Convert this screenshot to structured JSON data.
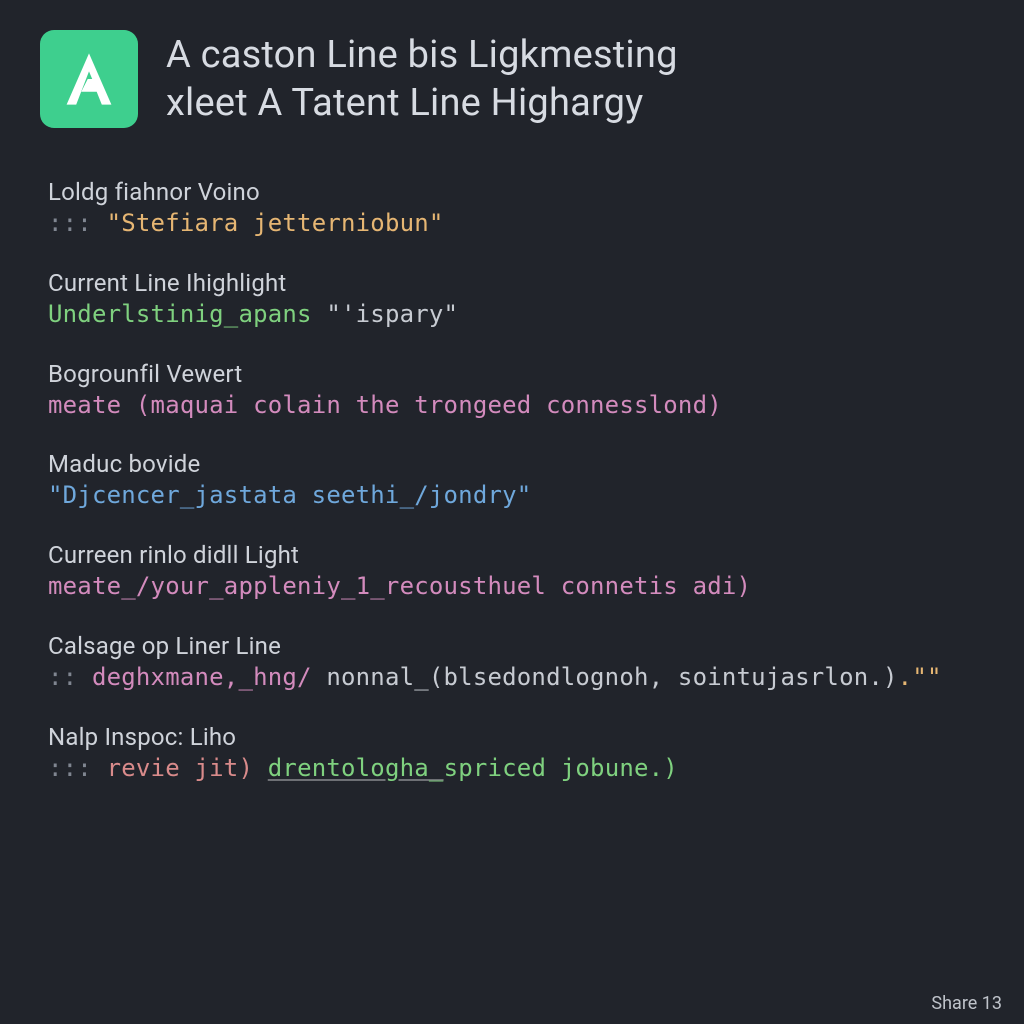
{
  "header": {
    "title_line1": "A caston Line bis Ligkmesting",
    "title_line2": "xleet A Tatent Line Highargy"
  },
  "groups": [
    {
      "label": "Loldg fiahnor Voino",
      "parts": [
        {
          "cls": "c-marker",
          "text": "::: "
        },
        {
          "cls": "c-orange",
          "text": "\"Stefiara jetterniobun\""
        }
      ]
    },
    {
      "label": "Current Line Ihighlight",
      "parts": [
        {
          "cls": "c-green",
          "text": "Underlstinig_apans "
        },
        {
          "cls": "c-gray",
          "text": "\"'ispary\""
        }
      ]
    },
    {
      "label": "Bogrounfil Vewert",
      "parts": [
        {
          "cls": "c-pink",
          "text": "meate "
        },
        {
          "cls": "c-pink",
          "text": "(maquai colain the trongeed connesslond)"
        }
      ]
    },
    {
      "label": "Maduc bovide",
      "parts": [
        {
          "cls": "c-blue",
          "text": "\"Djcencer_jastata seethi_/jondry\""
        }
      ]
    },
    {
      "label": "Curreen rinlo didll Light",
      "parts": [
        {
          "cls": "c-pink",
          "text": "meate_/your_appleniy_1_recousthuel connetis adi)"
        }
      ]
    },
    {
      "label": "Calsage op Liner Line",
      "parts": [
        {
          "cls": "c-marker",
          "text": ":: "
        },
        {
          "cls": "c-pink",
          "text": "deghxmane,_hng/ "
        },
        {
          "cls": "c-gray",
          "text": "nonnal_(blsedondlognoh, sointujasrlon.)"
        },
        {
          "cls": "c-orange",
          "text": ".\"\""
        }
      ]
    },
    {
      "label": "Nalp Inspoc: Liho",
      "parts": [
        {
          "cls": "c-marker",
          "text": "::: "
        },
        {
          "cls": "c-red",
          "text": "revie jit) "
        },
        {
          "cls": "c-green ul",
          "text": "drentologha_"
        },
        {
          "cls": "c-green",
          "text": "spriced jobune.)"
        }
      ]
    }
  ],
  "footer": {
    "share": "Share 13"
  }
}
